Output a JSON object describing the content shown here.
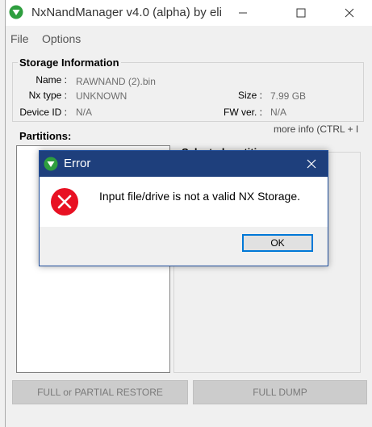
{
  "window": {
    "title": "NxNandManager v4.0 (alpha) by eli"
  },
  "menu": [
    "File",
    "Options"
  ],
  "storage": {
    "title": "Storage Information",
    "name_label": "Name :",
    "name_value": "RAWNAND (2).bin",
    "nxtype_label": "Nx type :",
    "nxtype_value": "UNKNOWN",
    "deviceid_label": "Device ID :",
    "deviceid_value": "N/A",
    "size_label": "Size :",
    "size_value": "7.99 GB",
    "fw_label": "FW ver. :",
    "fw_value": "N/A",
    "more_info": "more info (CTRL + I"
  },
  "partitions": {
    "title": "Partitions:",
    "selected_title": "Selected partition:"
  },
  "buttons": {
    "restore": "FULL or PARTIAL RESTORE",
    "dump": "FULL DUMP"
  },
  "dialog": {
    "title": "Error",
    "message": "Input file/drive is not a valid NX Storage.",
    "ok": "OK"
  },
  "colors": {
    "dialog_title_bg": "#1e3f7c",
    "error_icon": "#e81123",
    "accent": "#0078d7"
  }
}
